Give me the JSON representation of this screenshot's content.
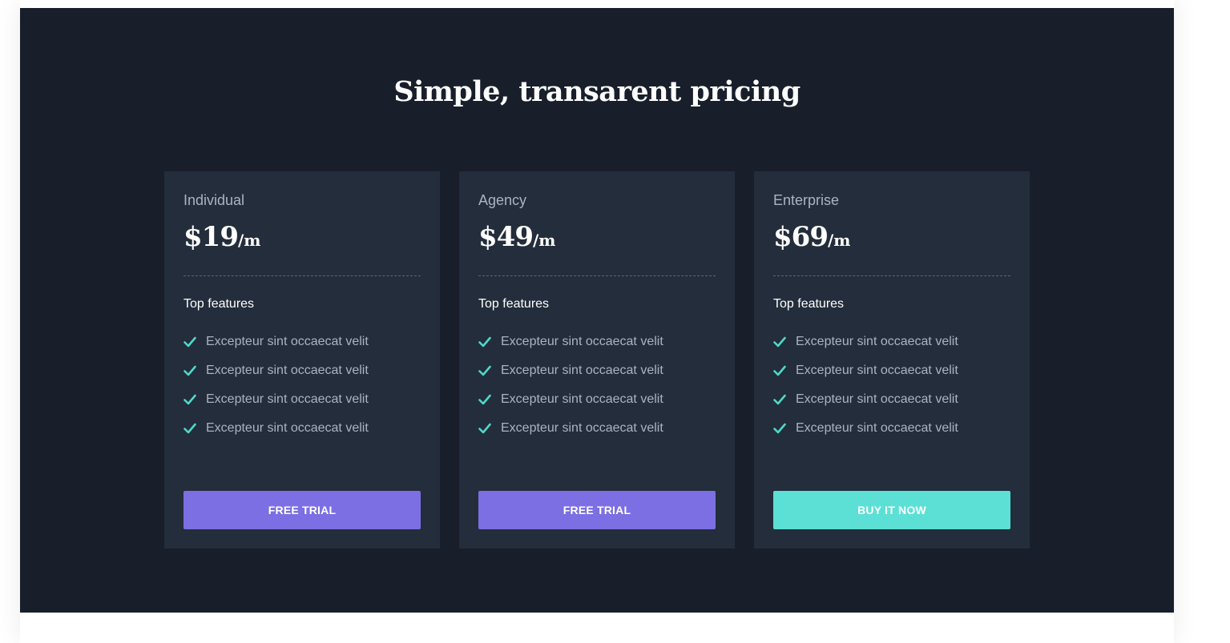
{
  "section": {
    "title": "Simple, transarent pricing"
  },
  "colors": {
    "background": "#181f2b",
    "card": "#232d3b",
    "accent_purple": "#7b6fe3",
    "accent_teal": "#5ce0d5",
    "check": "#4fd8c8"
  },
  "plans": [
    {
      "name": "Individual",
      "amount": "$19",
      "period": "/m",
      "features_heading": "Top features",
      "features": [
        "Excepteur sint occaecat velit",
        "Excepteur sint occaecat velit",
        "Excepteur sint occaecat velit",
        "Excepteur sint occaecat velit"
      ],
      "button_label": "FREE TRIAL"
    },
    {
      "name": "Agency",
      "amount": "$49",
      "period": "/m",
      "features_heading": "Top features",
      "features": [
        "Excepteur sint occaecat velit",
        "Excepteur sint occaecat velit",
        "Excepteur sint occaecat velit",
        "Excepteur sint occaecat velit"
      ],
      "button_label": "FREE TRIAL"
    },
    {
      "name": "Enterprise",
      "amount": "$69",
      "period": "/m",
      "features_heading": "Top features",
      "features": [
        "Excepteur sint occaecat velit",
        "Excepteur sint occaecat velit",
        "Excepteur sint occaecat velit",
        "Excepteur sint occaecat velit"
      ],
      "button_label": "BUY IT NOW"
    }
  ]
}
